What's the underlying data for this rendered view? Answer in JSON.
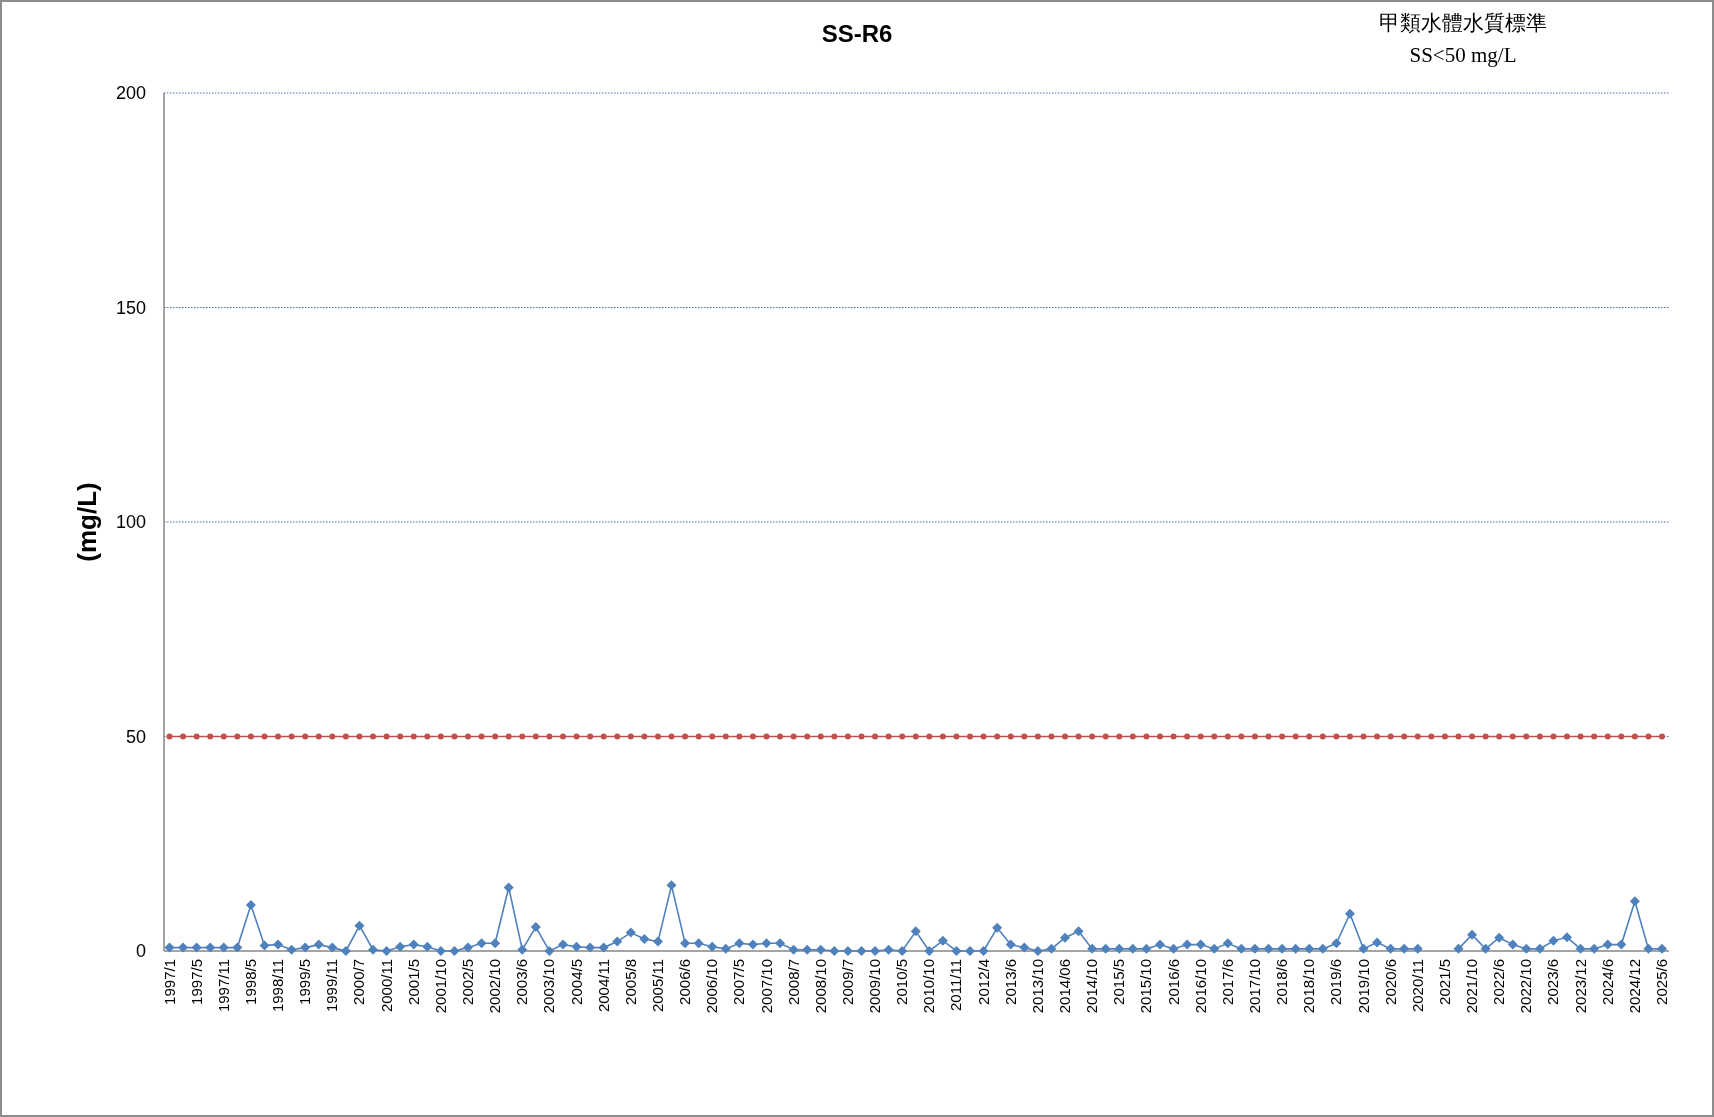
{
  "note": [
    "甲類水體水質標準",
    "SS<50 mg/L"
  ],
  "chart_data": {
    "type": "line",
    "title": "SS-R6",
    "ylabel": "(mg/L)",
    "ylim": [
      0,
      200
    ],
    "yticks": [
      0,
      50,
      100,
      150,
      200
    ],
    "grid": true,
    "categories": [
      "1997/1",
      null,
      "1997/5",
      null,
      "1997/11",
      null,
      "1998/5",
      null,
      "1998/11",
      null,
      "1999/5",
      null,
      "1999/11",
      null,
      "2000/7",
      null,
      "2000/11",
      null,
      "2001/5",
      null,
      "2001/10",
      null,
      "2002/5",
      null,
      "2002/10",
      null,
      "2003/6",
      null,
      "2003/10",
      null,
      "2004/5",
      null,
      "2004/11",
      null,
      "2005/8",
      null,
      "2005/11",
      null,
      "2006/6",
      null,
      "2006/10",
      null,
      "2007/5",
      null,
      "2007/10",
      null,
      "2008/7",
      null,
      "2008/10",
      null,
      "2009/7",
      null,
      "2009/10",
      null,
      "2010/5",
      null,
      "2010/10",
      null,
      "2011/11",
      null,
      "2012/4",
      null,
      "2013/6",
      null,
      "2013/10",
      null,
      "2014/06",
      null,
      "2014/10",
      null,
      "2015/5",
      null,
      "2015/10",
      null,
      "2016/6",
      null,
      "2016/10",
      null,
      "2017/6",
      null,
      "2017/10",
      null,
      "2018/6",
      null,
      "2018/10",
      null,
      "2019/6",
      null,
      "2019/10",
      null,
      "2020/6",
      null,
      "2020/11",
      null,
      "2021/5",
      null,
      "2021/10",
      null,
      "2022/6",
      null,
      "2022/10",
      null,
      "2023/6",
      null,
      "2023/12",
      null,
      "2024/6",
      null,
      "2024/12",
      null,
      "2025/6"
    ],
    "series": [
      {
        "color": "#4f81bd",
        "marker": "diamond",
        "values": [
          0.8,
          0.8,
          0.8,
          0.8,
          0.8,
          0.8,
          10.7,
          1.3,
          1.5,
          0.3,
          0.8,
          1.5,
          0.8,
          0,
          5.9,
          0.3,
          0,
          1.0,
          1.5,
          1.0,
          0,
          0,
          0.8,
          1.8,
          1.8,
          14.8,
          0.3,
          5.6,
          0,
          1.5,
          1.0,
          0.8,
          0.8,
          2.2,
          4.3,
          2.8,
          2.2,
          15.3,
          1.8,
          1.8,
          1.0,
          0.5,
          1.8,
          1.5,
          1.8,
          1.8,
          0.3,
          0.3,
          0.3,
          0,
          0,
          0,
          0,
          0.3,
          0,
          4.6,
          0,
          2.4,
          0,
          0,
          0,
          5.4,
          1.5,
          0.8,
          0,
          0.5,
          3.1,
          4.6,
          0.5,
          0.5,
          0.5,
          0.5,
          0.5,
          1.5,
          0.5,
          1.5,
          1.5,
          0.5,
          1.8,
          0.5,
          0.5,
          0.5,
          0.5,
          0.5,
          0.5,
          0.5,
          1.8,
          8.7,
          0.5,
          2.0,
          0.5,
          0.5,
          0.5,
          null,
          null,
          0.5,
          3.8,
          0.5,
          3.1,
          1.5,
          0.5,
          0.5,
          2.4,
          3.2,
          0.5,
          0.5,
          1.5,
          1.5,
          11.6,
          0.5,
          0.5
        ]
      },
      {
        "color": "#c0504d",
        "marker": "circle",
        "values": [
          50,
          50,
          50,
          50,
          50,
          50,
          50,
          50,
          50,
          50,
          50,
          50,
          50,
          50,
          50,
          50,
          50,
          50,
          50,
          50,
          50,
          50,
          50,
          50,
          50,
          50,
          50,
          50,
          50,
          50,
          50,
          50,
          50,
          50,
          50,
          50,
          50,
          50,
          50,
          50,
          50,
          50,
          50,
          50,
          50,
          50,
          50,
          50,
          50,
          50,
          50,
          50,
          50,
          50,
          50,
          50,
          50,
          50,
          50,
          50,
          50,
          50,
          50,
          50,
          50,
          50,
          50,
          50,
          50,
          50,
          50,
          50,
          50,
          50,
          50,
          50,
          50,
          50,
          50,
          50,
          50,
          50,
          50,
          50,
          50,
          50,
          50,
          50,
          50,
          50,
          50,
          50,
          50,
          50,
          50,
          50,
          50,
          50,
          50,
          50,
          50,
          50,
          50,
          50,
          50,
          50,
          50,
          50,
          50,
          50,
          50
        ]
      }
    ]
  }
}
